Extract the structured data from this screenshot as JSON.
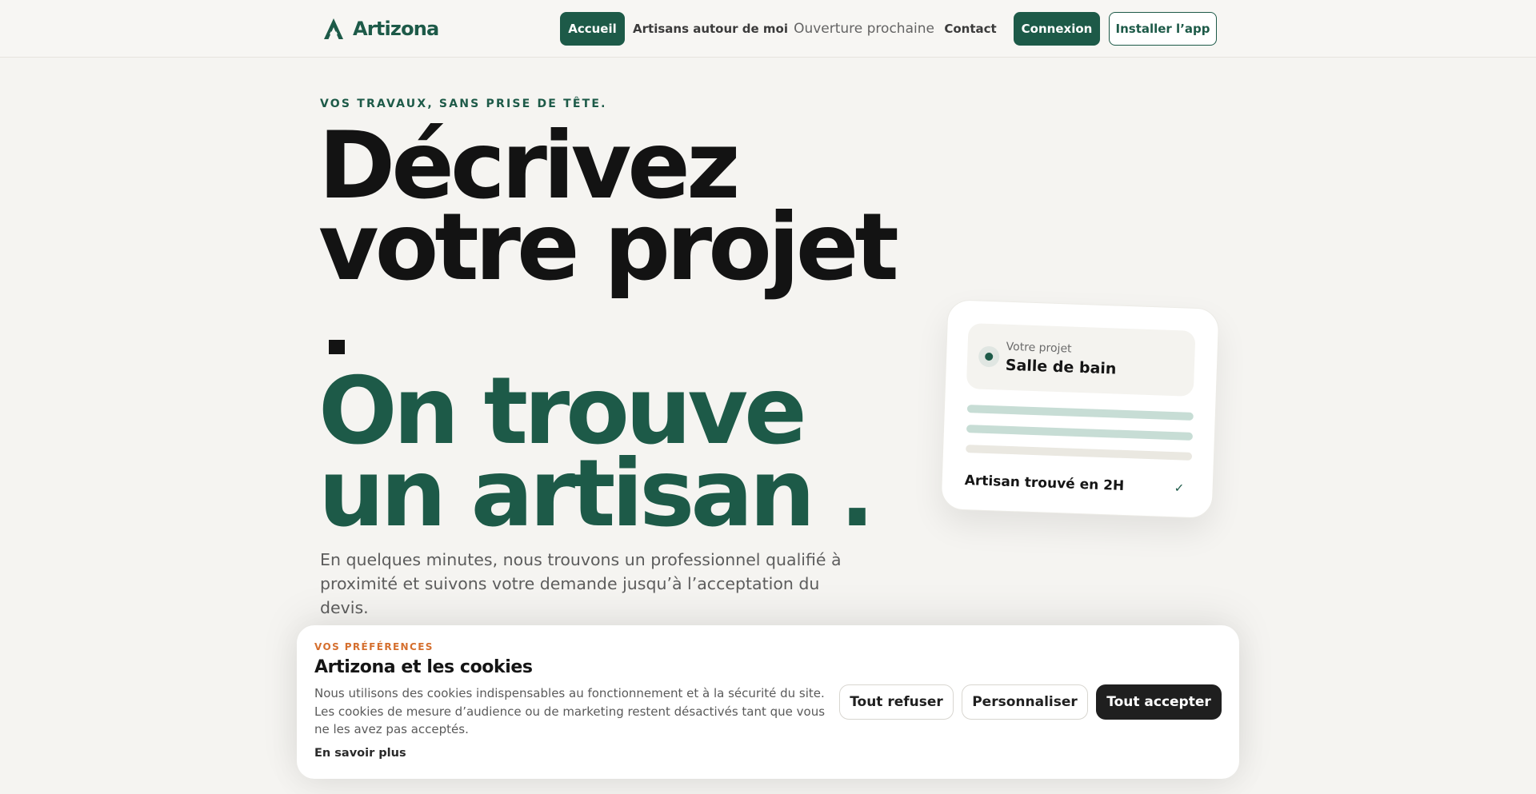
{
  "brand": {
    "name": "Artizona",
    "color": "#1d5a48",
    "logo_icon": "artizona-a-icon"
  },
  "nav": {
    "items": [
      {
        "label": "Accueil",
        "active": true
      },
      {
        "label": "Artisans autour de moi"
      },
      {
        "label": "Ouverture prochaine"
      },
      {
        "label": "Contact"
      }
    ],
    "login_label": "Connexion",
    "install_label": "Installer l’app"
  },
  "hero": {
    "eyebrow": "VOS TRAVAUX, SANS PRISE DE TÊTE.",
    "line1": "Décrivez",
    "line2": "votre projet",
    "line3": "On trouve",
    "line4": "un artisan .",
    "lede": "En quelques minutes, nous trouvons un professionnel qualifié à proximité et suivons votre demande jusqu’à l’acceptation du devis."
  },
  "project_card": {
    "label": "Votre projet",
    "title": "Salle de bain",
    "footer": "Artisan trouvé en 2H",
    "check_icon": "✓"
  },
  "cookie_banner": {
    "eyebrow": "VOS PRÉFÉRENCES",
    "title": "Artizona et les cookies",
    "text": "Nous utilisons des cookies indispensables au fonctionnement et à la sécurité du site. Les cookies de mesure d’audience ou de marketing restent désactivés tant que vous ne les avez pas acceptés.",
    "learn_more": "En savoir plus",
    "refuse_label": "Tout refuser",
    "customize_label": "Personnaliser",
    "accept_label": "Tout accepter",
    "accent_color": "#d56f2e"
  }
}
